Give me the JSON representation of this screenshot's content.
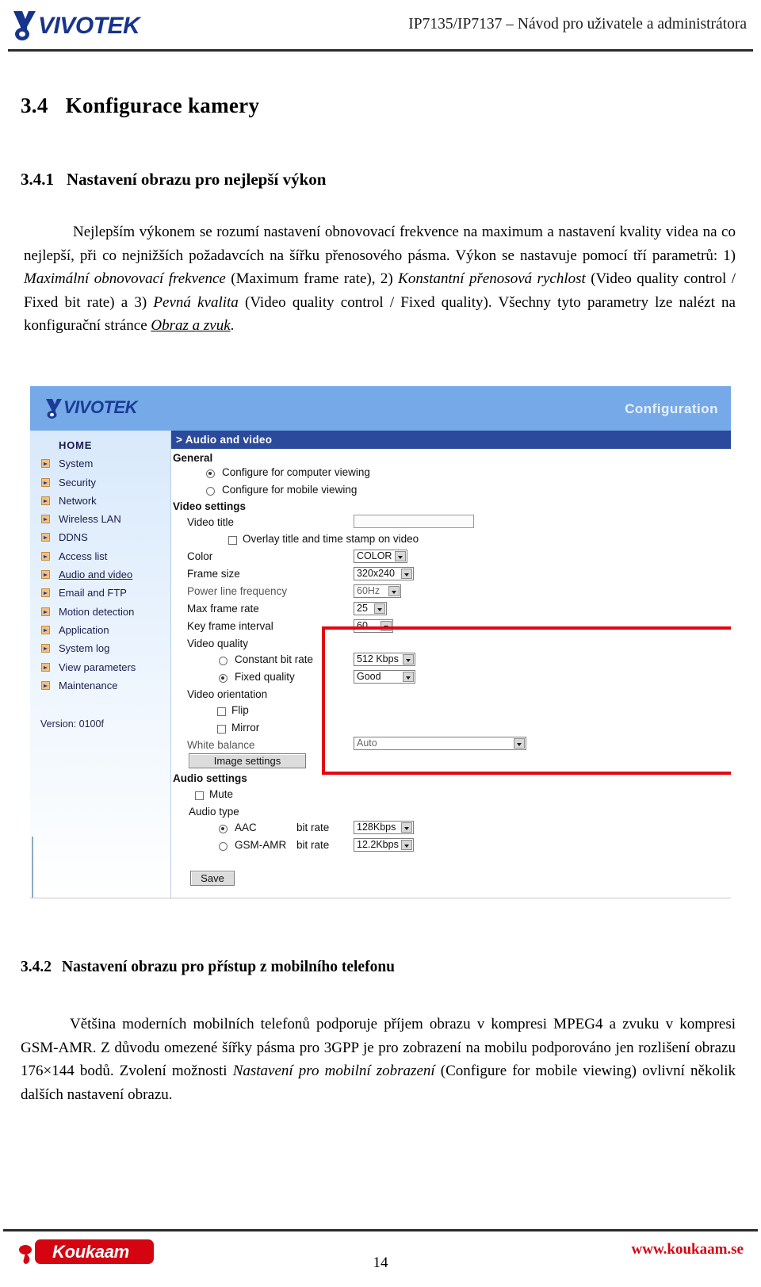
{
  "header": {
    "logo_text": "VIVOTEK",
    "logo_icon": "vivotek-bird-logo",
    "doc_title": "IP7135/IP7137 – Návod pro uživatele a administrátora"
  },
  "sections": {
    "s34": {
      "number": "3.4",
      "title": "Konfigurace kamery"
    },
    "s341": {
      "number": "3.4.1",
      "title": "Nastavení obrazu pro nejlepší výkon"
    },
    "s342": {
      "number": "3.4.2",
      "title": "Nastavení obrazu pro přístup z mobilního telefonu"
    }
  },
  "paragraphs": {
    "p1_part1": "Nejlepším výkonem se rozumí nastavení obnovovací frekvence na maximum a nastavení kvality videa na co nejlepší, při co nejnižších požadavcích na šířku přenosového pásma. Výkon se nastavuje pomocí tří parametrů: 1) ",
    "p1_i1": "Maximální obnovovací frekvence",
    "p1_part2": " (Maximum frame rate), 2) ",
    "p1_i2": "Konstantní přenosová rychlost",
    "p1_part3": " (Video quality control / Fixed bit rate) a 3) ",
    "p1_i3": "Pevná kvalita",
    "p1_part4": " (Video quality control / Fixed quality). Všechny tyto parametry lze nalézt na konfigurační stránce ",
    "p1_link": "Obraz a zvuk",
    "p1_part5": ".",
    "p2_part1": "Většina moderních mobilních telefonů podporuje příjem obrazu v kompresi MPEG4 a zvuku v kompresi GSM-AMR. Z důvodu omezené šířky pásma pro 3GPP je pro zobrazení na mobilu podporováno jen rozlišení obrazu 176×144 bodů. Zvolení možnosti ",
    "p2_i1": "Nastavení pro mobilní zobrazení",
    "p2_part2": " (Configure for mobile viewing) ovlivní několik dalších nastavení obrazu."
  },
  "screenshot": {
    "brand": "VIVOTEK",
    "config_label": "Configuration",
    "breadcrumb": "> Audio and video",
    "sidebar": {
      "items": [
        {
          "label": "HOME",
          "icon": "none",
          "active": false
        },
        {
          "label": "System",
          "icon": "arrow-bullet-icon",
          "active": false
        },
        {
          "label": "Security",
          "icon": "arrow-bullet-icon",
          "active": false
        },
        {
          "label": "Network",
          "icon": "arrow-bullet-icon",
          "active": false
        },
        {
          "label": "Wireless LAN",
          "icon": "arrow-bullet-icon",
          "active": false
        },
        {
          "label": "DDNS",
          "icon": "arrow-bullet-icon",
          "active": false
        },
        {
          "label": "Access list",
          "icon": "arrow-bullet-icon",
          "active": false
        },
        {
          "label": "Audio and video",
          "icon": "arrow-bullet-icon",
          "active": true
        },
        {
          "label": "Email and FTP",
          "icon": "arrow-bullet-icon",
          "active": false
        },
        {
          "label": "Motion detection",
          "icon": "arrow-bullet-icon",
          "active": false
        },
        {
          "label": "Application",
          "icon": "arrow-bullet-icon",
          "active": false
        },
        {
          "label": "System log",
          "icon": "arrow-bullet-icon",
          "active": false
        },
        {
          "label": "View parameters",
          "icon": "arrow-bullet-icon",
          "active": false
        },
        {
          "label": "Maintenance",
          "icon": "arrow-bullet-icon",
          "active": false
        }
      ],
      "version": "Version: 0100f"
    },
    "groups": {
      "general": "General",
      "video_settings": "Video settings",
      "video_quality": "Video quality",
      "video_orientation": "Video orientation",
      "audio_settings": "Audio settings",
      "audio_type": "Audio type"
    },
    "fields": {
      "radio_computer_viewing": "Configure for computer viewing",
      "radio_mobile_viewing": "Configure for mobile viewing",
      "video_title_label": "Video title",
      "video_title_value": "",
      "overlay_label": "Overlay title and time stamp on video",
      "color_label": "Color",
      "color_value": "COLOR",
      "frame_size_label": "Frame size",
      "frame_size_value": "320x240",
      "power_line_label": "Power line frequency",
      "power_line_value": "60Hz",
      "max_frame_rate_label": "Max frame rate",
      "max_frame_rate_value": "25",
      "key_frame_label": "Key frame interval",
      "key_frame_value": "60",
      "constant_bit_rate_label": "Constant bit rate",
      "constant_bit_rate_value": "512 Kbps",
      "fixed_quality_label": "Fixed quality",
      "fixed_quality_value": "Good",
      "flip_label": "Flip",
      "mirror_label": "Mirror",
      "white_balance_label": "White balance",
      "white_balance_value": "Auto",
      "image_settings_button": "Image settings",
      "mute_label": "Mute",
      "aac_label": "AAC",
      "aac_bitrate_label": "bit rate",
      "aac_bitrate_value": "128Kbps",
      "gsm_label": "GSM-AMR",
      "gsm_bitrate_label": "bit rate",
      "gsm_bitrate_value": "12.2Kbps",
      "save_button": "Save"
    },
    "highlight_color": "#e30613"
  },
  "footer": {
    "logo_text": "Koukaam",
    "url": "www.koukaam.se",
    "page_number": "14"
  }
}
